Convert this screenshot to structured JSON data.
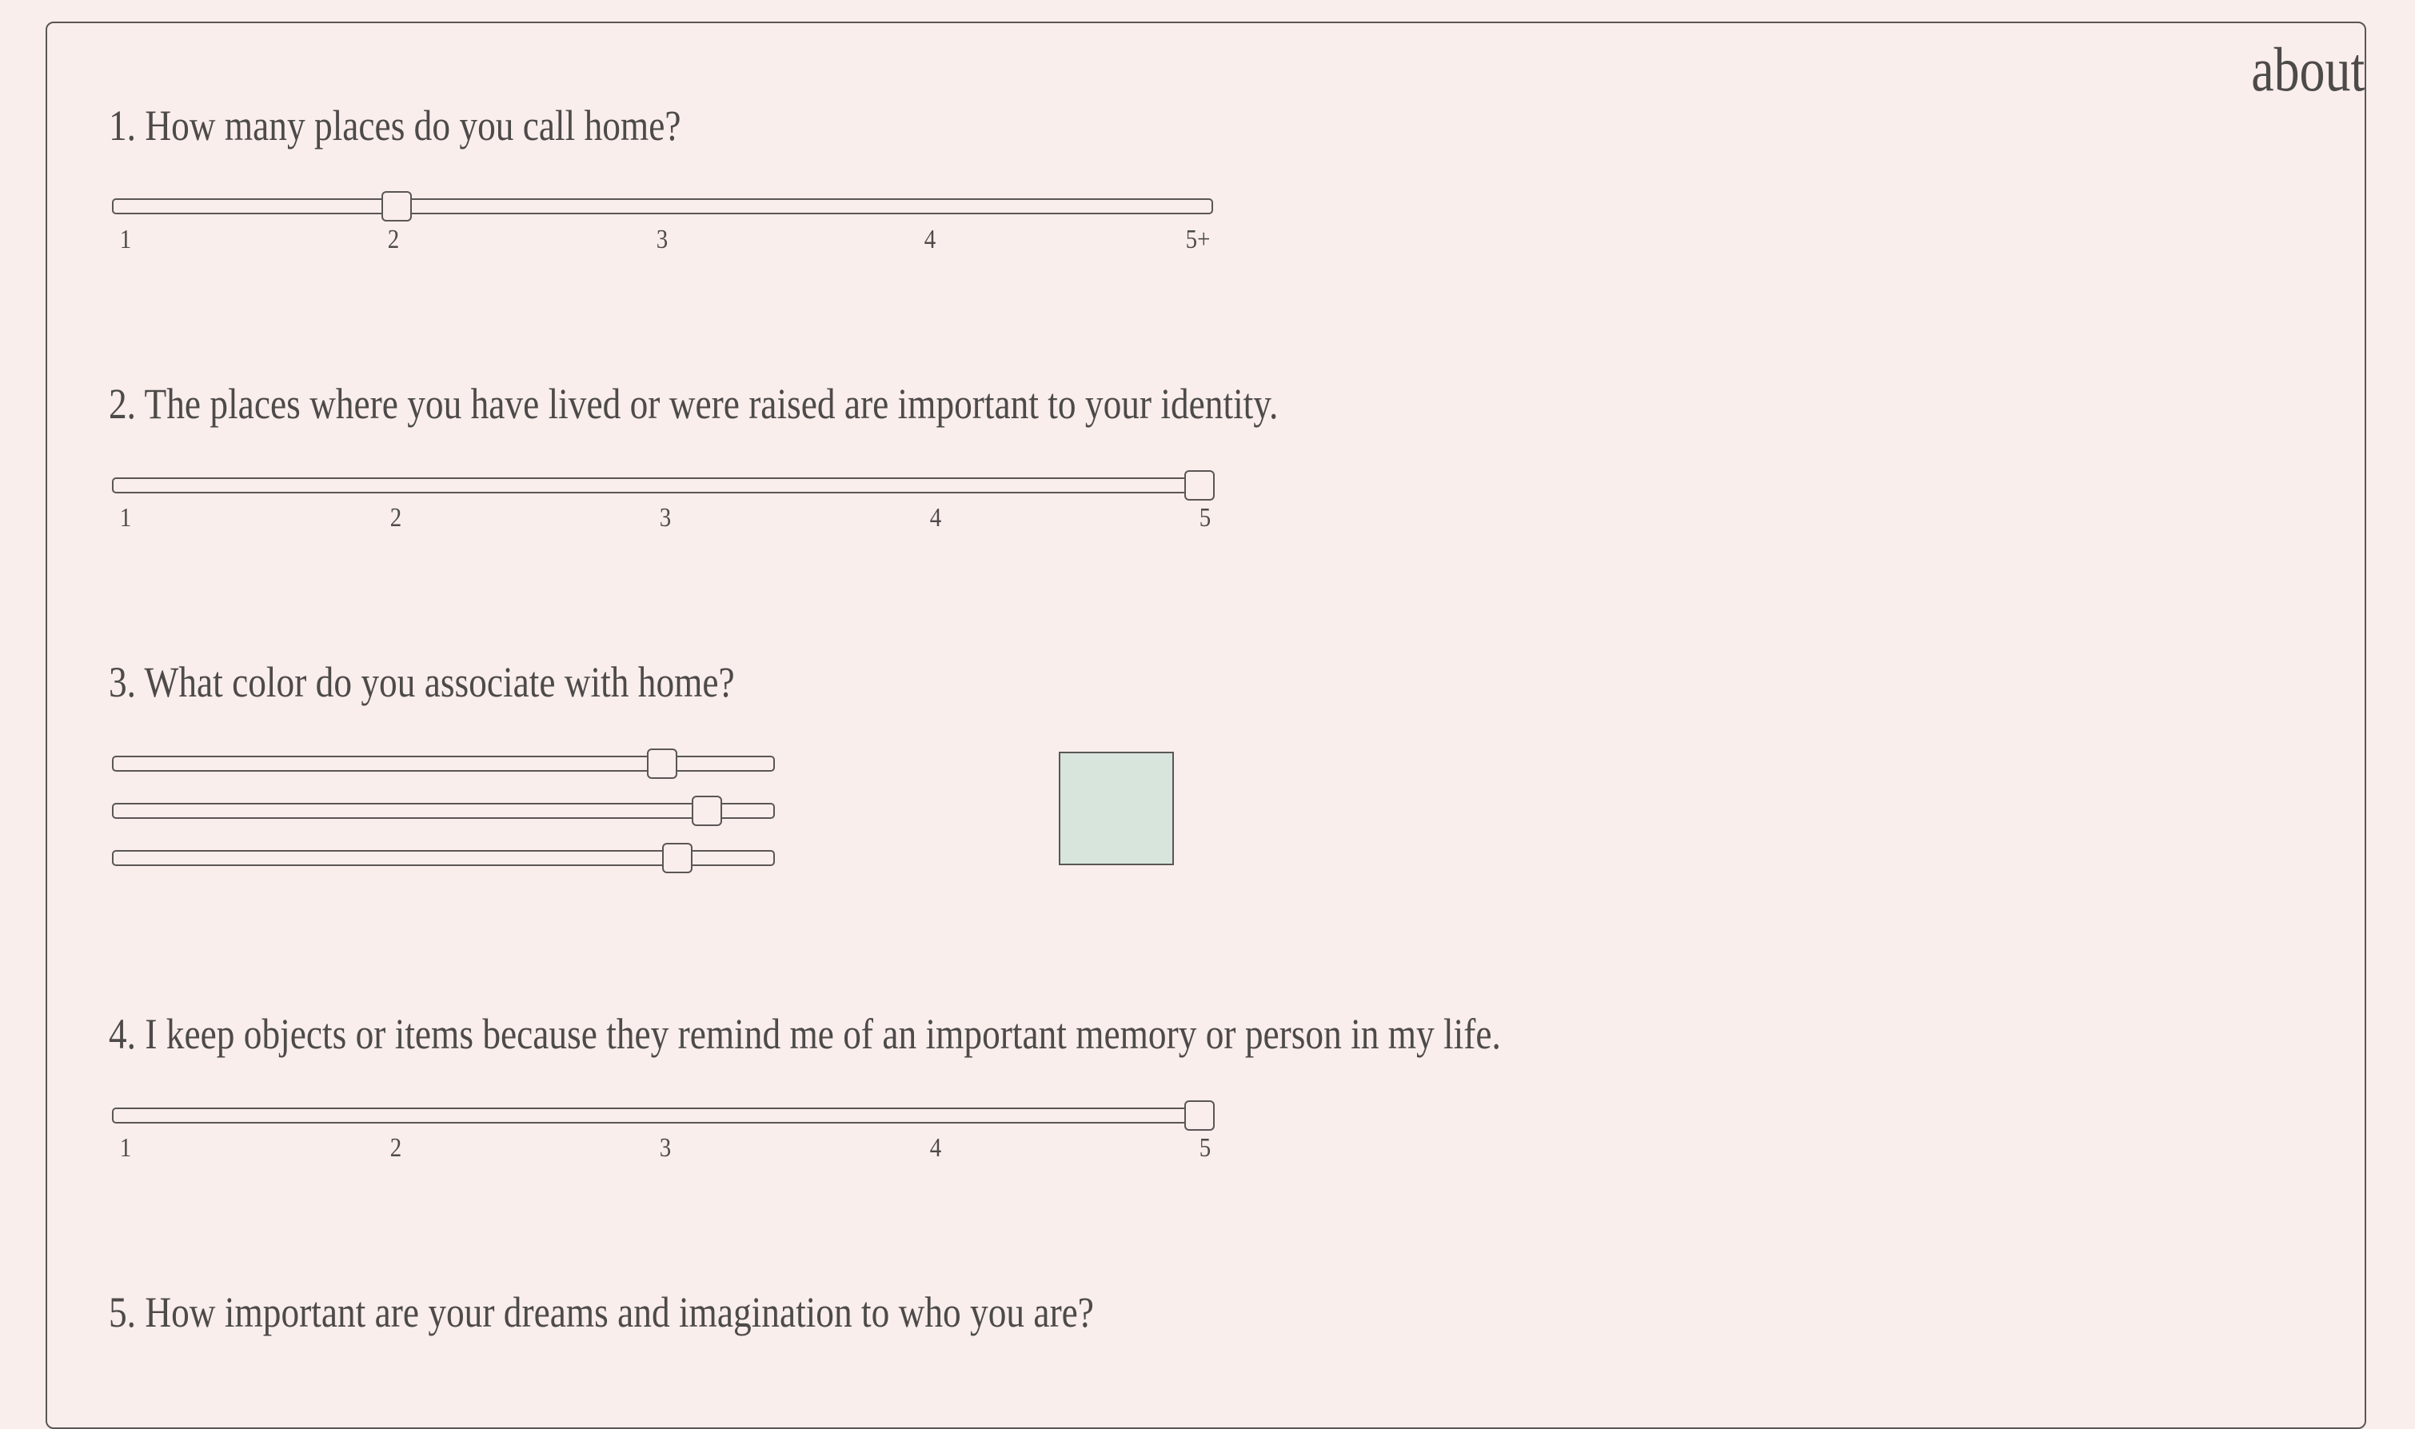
{
  "nav": {
    "about_label": "about"
  },
  "questions": [
    {
      "text": "1. How many places do you call home?",
      "slider": {
        "min": 1,
        "max": 5,
        "value": 2,
        "ticks": [
          "1",
          "2",
          "3",
          "4",
          "5+"
        ]
      }
    },
    {
      "text": "2. The places where you have lived or were raised are important to your identity.",
      "slider": {
        "min": 1,
        "max": 5,
        "value": 5,
        "ticks": [
          "1",
          "2",
          "3",
          "4",
          "5"
        ]
      }
    },
    {
      "text": "3. What color do you associate with home?",
      "color_sliders": [
        {
          "channel": "red",
          "min": 0,
          "max": 255,
          "value": 215
        },
        {
          "channel": "green",
          "min": 0,
          "max": 255,
          "value": 233
        },
        {
          "channel": "blue",
          "min": 0,
          "max": 255,
          "value": 221
        }
      ],
      "swatch_color": "#d7e5dc"
    },
    {
      "text": "4. I keep objects or items because they remind me of an important memory or person in my life.",
      "slider": {
        "min": 1,
        "max": 5,
        "value": 5,
        "ticks": [
          "1",
          "2",
          "3",
          "4",
          "5"
        ]
      }
    },
    {
      "text": "5. How important are your dreams and imagination to who you are?"
    }
  ],
  "colors": {
    "background": "#f9eeeb",
    "border": "#5a5656",
    "text": "#4d4a4a"
  }
}
